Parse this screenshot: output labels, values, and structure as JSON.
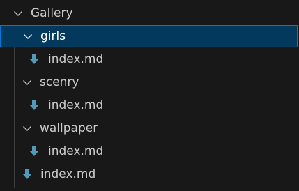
{
  "tree": {
    "root": {
      "label": "Gallery",
      "icon": "chevron-down-icon"
    },
    "folders": [
      {
        "label": "girls",
        "icon": "chevron-down-icon",
        "selected": true,
        "file": {
          "label": "index.md",
          "icon": "markdown-file-icon"
        }
      },
      {
        "label": "scenry",
        "icon": "chevron-down-icon",
        "selected": false,
        "file": {
          "label": "index.md",
          "icon": "markdown-file-icon"
        }
      },
      {
        "label": "wallpaper",
        "icon": "chevron-down-icon",
        "selected": false,
        "file": {
          "label": "index.md",
          "icon": "markdown-file-icon"
        }
      }
    ],
    "root_file": {
      "label": "index.md",
      "icon": "markdown-file-icon"
    }
  },
  "colors": {
    "background": "#181818",
    "selection_bg": "#04395e",
    "selection_border": "#0078d4",
    "markdown_icon": "#519aba",
    "text": "#cccccc"
  }
}
